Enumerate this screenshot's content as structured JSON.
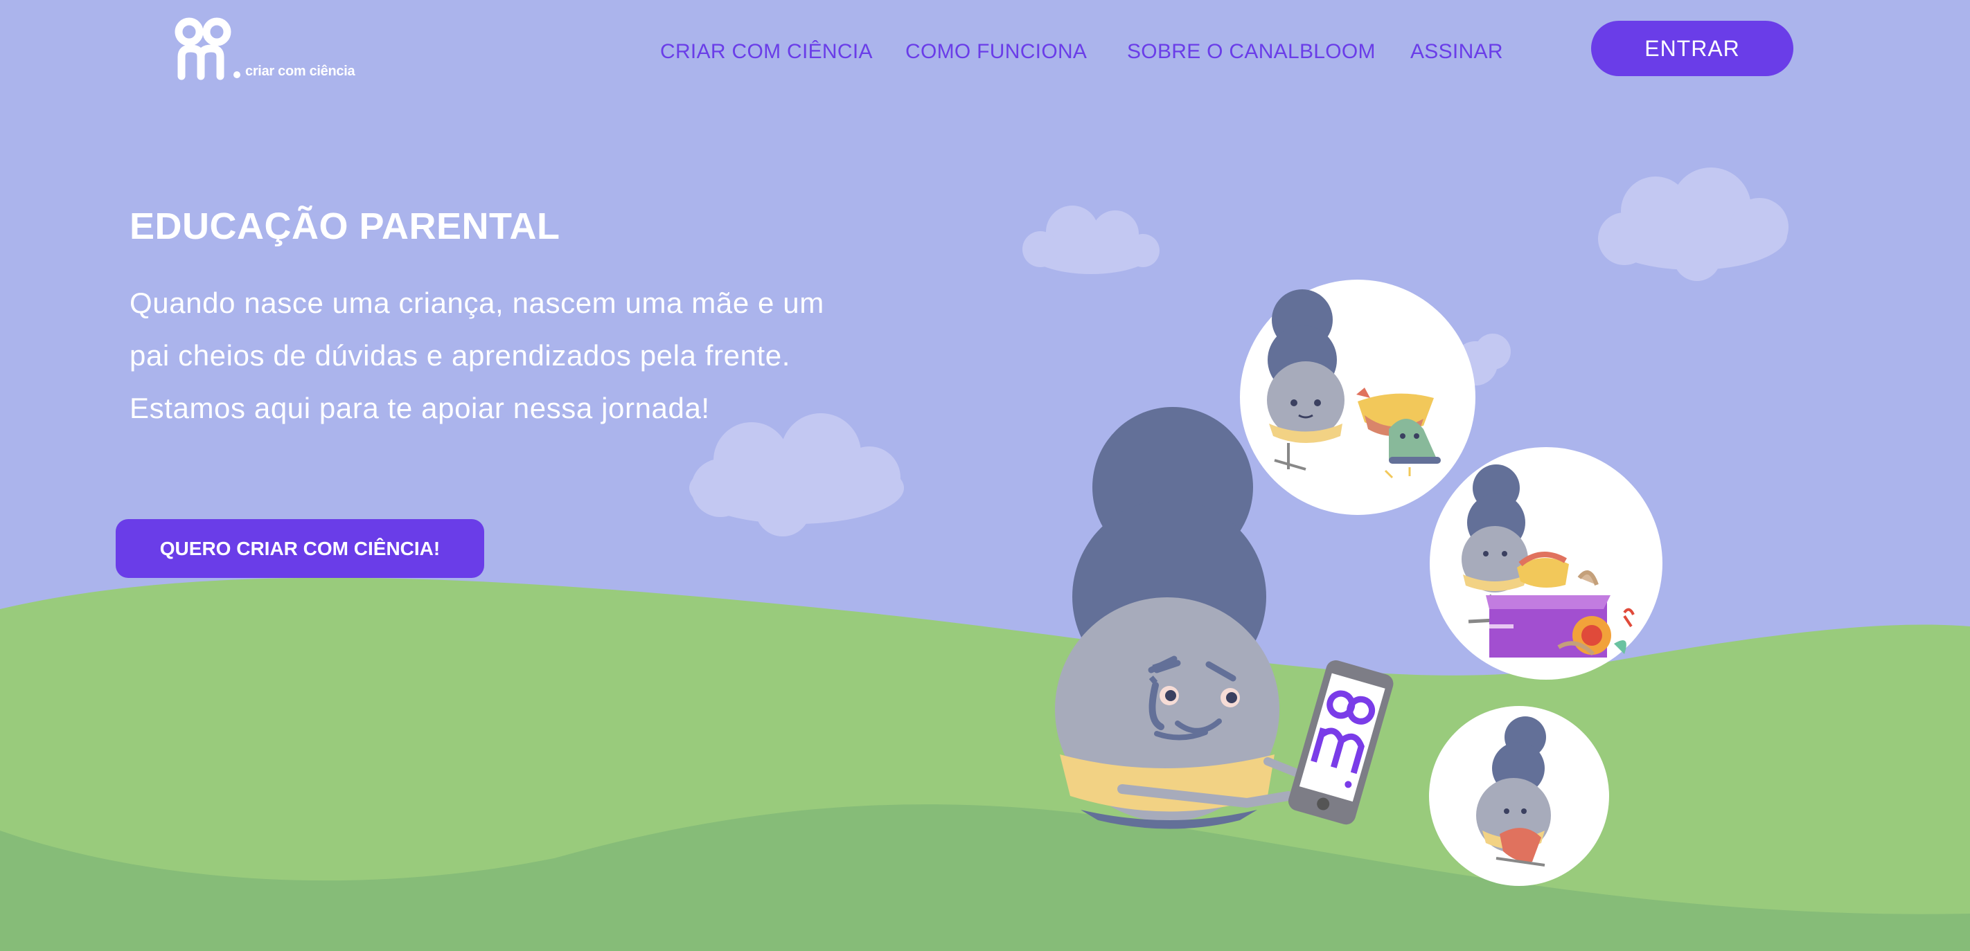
{
  "header": {
    "logo_text": "criar com ciência",
    "nav": [
      {
        "label": "CRIAR COM CIÊNCIA"
      },
      {
        "label": "COMO FUNCIONA"
      },
      {
        "label": "SOBRE O CANALBLOOM"
      },
      {
        "label": "ASSINAR"
      }
    ],
    "login_label": "ENTRAR"
  },
  "hero": {
    "title": "EDUCAÇÃO PARENTAL",
    "text": "Quando nasce uma criança, nascem uma mãe e um pai cheios de dúvidas e aprendizados pela frente. Estamos aqui para te apoiar nessa jornada!",
    "cta_label": "QUERO CRIAR COM CIÊNCIA!"
  },
  "colors": {
    "sky": "#abb4ec",
    "accent": "#6a3de8",
    "hill_light": "#99cb7c",
    "hill_dark": "#86bc78"
  }
}
